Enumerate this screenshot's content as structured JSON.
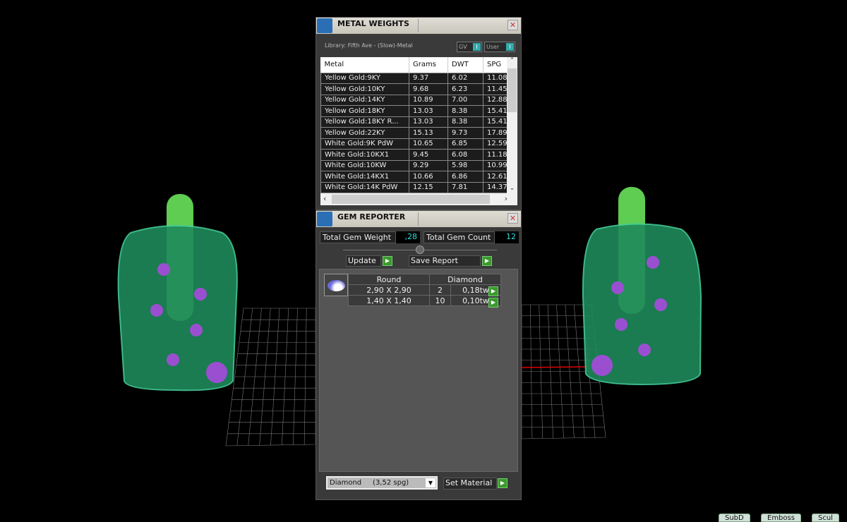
{
  "metal_weights": {
    "title": "METAL WEIGHTS",
    "library": "Library: Fifth Ave - (Slow)-Metal",
    "toggles": [
      {
        "label": "GV",
        "value": "I"
      },
      {
        "label": "User",
        "value": "I"
      }
    ],
    "columns": [
      "Metal",
      "Grams",
      "DWT",
      "SPG"
    ],
    "rows": [
      [
        "Yellow Gold:9KY",
        "9.37",
        "6.02",
        "11.08"
      ],
      [
        "Yellow Gold:10KY",
        "9.68",
        "6.23",
        "11.45"
      ],
      [
        "Yellow Gold:14KY",
        "10.89",
        "7.00",
        "12.88"
      ],
      [
        "Yellow Gold:18KY",
        "13.03",
        "8.38",
        "15.41"
      ],
      [
        "Yellow Gold:18KY R...",
        "13.03",
        "8.38",
        "15.41"
      ],
      [
        "Yellow Gold:22KY",
        "15.13",
        "9.73",
        "17.89"
      ],
      [
        "White Gold:9K PdW",
        "10.65",
        "6.85",
        "12.59"
      ],
      [
        "White Gold:10KX1",
        "9.45",
        "6.08",
        "11.18"
      ],
      [
        "White Gold:10KW",
        "9.29",
        "5.98",
        "10.99"
      ],
      [
        "White Gold:14KX1",
        "10.66",
        "6.86",
        "12.61"
      ],
      [
        "White Gold:14K PdW",
        "12.15",
        "7.81",
        "14.37"
      ]
    ]
  },
  "gem_reporter": {
    "title": "GEM REPORTER",
    "total_weight_label": "Total Gem Weight",
    "total_weight": ",28",
    "total_count_label": "Total Gem Count",
    "total_count": "12",
    "update": "Update",
    "save_report": "Save Report",
    "gem_table": {
      "shape": "Round",
      "material": "Diamond",
      "rows": [
        [
          "2,90 X 2,90",
          "2",
          "0,18tw"
        ],
        [
          "1,40 X 1,40",
          "10",
          "0,10tw"
        ]
      ]
    },
    "material_select": "Diamond     (3,52 spg)",
    "set_material": "Set Material"
  },
  "bottom_tabs": [
    "SubD",
    "Emboss",
    "Scul"
  ],
  "colors": {
    "accent_green": "#3a9a2a",
    "value_cyan": "#33dddd",
    "model_green": "#1f8a5a"
  }
}
